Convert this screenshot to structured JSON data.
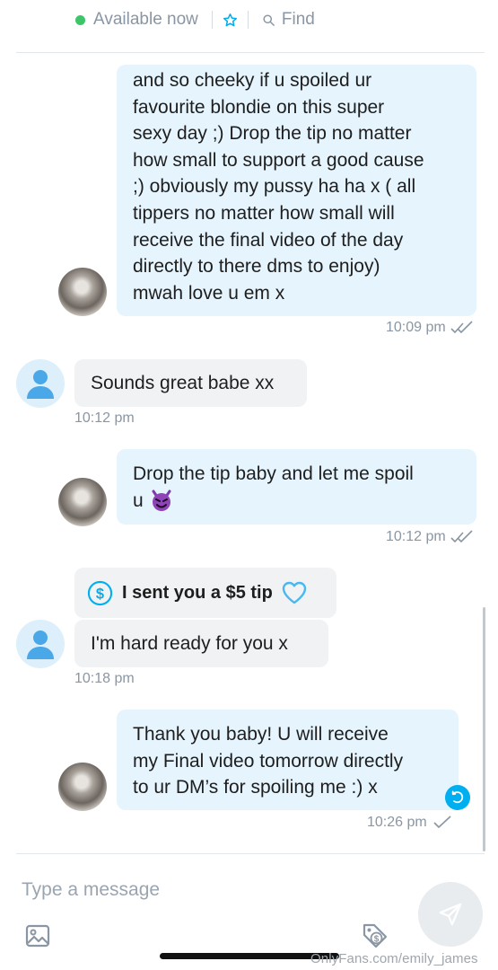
{
  "header": {
    "status_text": "Available now",
    "find_label": "Find"
  },
  "messages": [
    {
      "direction": "outgoing",
      "lines": [
        "and so cheeky if u spoiled ur",
        "favourite blondie on this super",
        "sexy day ;) Drop the tip no matter",
        "how small to support a good cause",
        ";) obviously my pussy ha ha x ( all",
        "tippers no matter how small will",
        "receive the final video of the day",
        "directly to there dms to enjoy)",
        "mwah love u em x"
      ],
      "time": "10:09 pm",
      "read": true
    },
    {
      "direction": "incoming",
      "text": "Sounds great babe xx",
      "time": "10:12 pm"
    },
    {
      "direction": "outgoing",
      "lines": [
        "Drop the tip baby and let me spoil",
        "u"
      ],
      "emoji": "😈",
      "time": "10:12 pm",
      "read": true
    },
    {
      "direction": "incoming",
      "type": "tip",
      "text": "I sent you a $5 tip"
    },
    {
      "direction": "incoming",
      "text": "I'm hard ready for you x",
      "time": "10:18 pm"
    },
    {
      "direction": "outgoing",
      "lines": [
        "Thank you baby! U will receive",
        "my Final video tomorrow directly",
        "to ur DM’s for spoiling me :) x"
      ],
      "time": "10:26 pm",
      "read": false
    }
  ],
  "composer": {
    "placeholder": "Type a message"
  },
  "watermark": "OnlyFans.com/emily_james",
  "colors": {
    "accent": "#00aff0",
    "online": "#3ec56a",
    "bubble_out": "#e5f4fd",
    "bubble_in": "#f0f2f4",
    "tip_heart": "#49b8f0"
  }
}
